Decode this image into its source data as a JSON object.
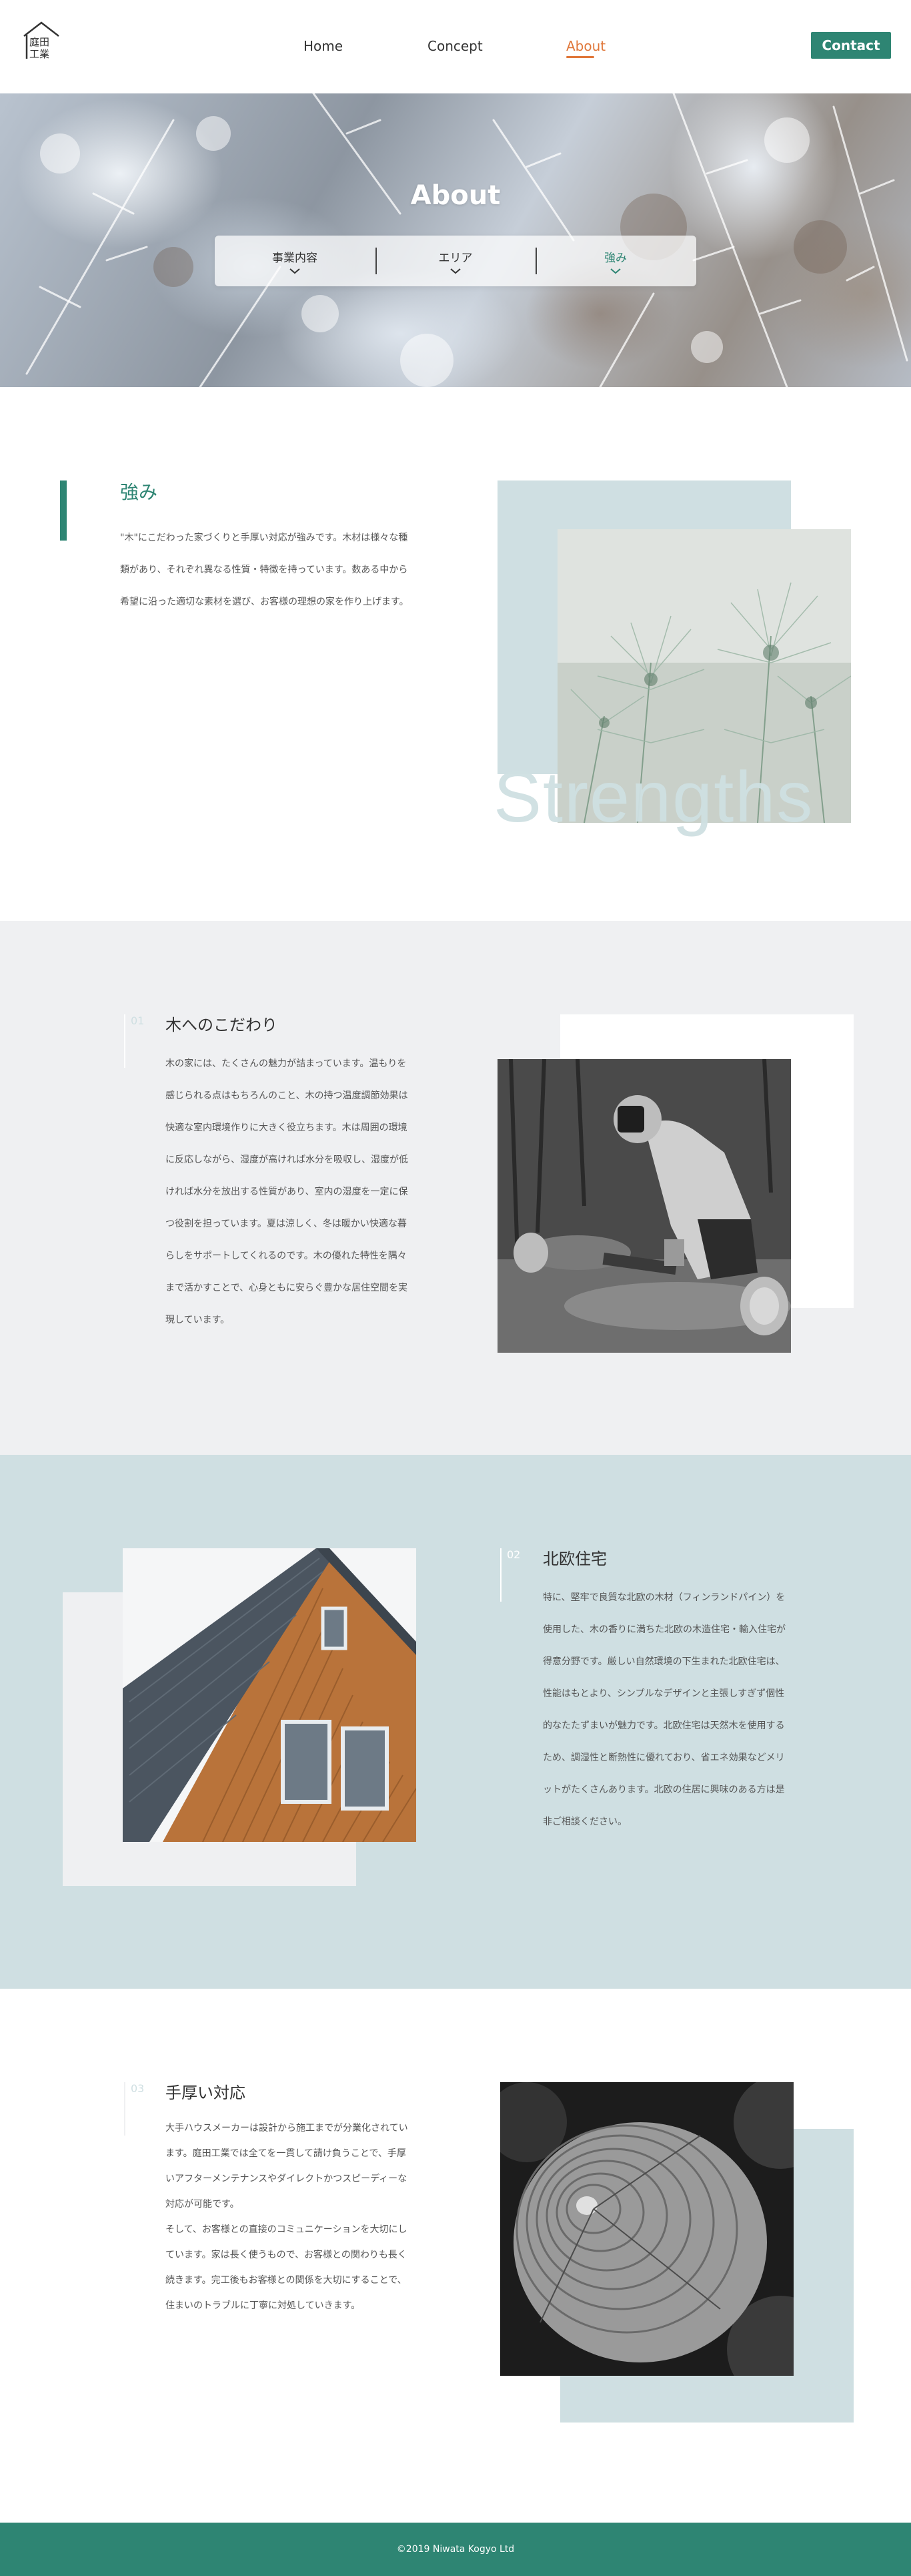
{
  "header": {
    "logo_text": "庭田工業",
    "nav": [
      {
        "label": "Home",
        "active": false
      },
      {
        "label": "Concept",
        "active": false
      },
      {
        "label": "About",
        "active": true
      }
    ],
    "contact_label": "Contact"
  },
  "hero": {
    "title": "About",
    "sub_nav": [
      {
        "label": "事業内容",
        "active": false
      },
      {
        "label": "エリア",
        "active": false
      },
      {
        "label": "強み",
        "active": true
      }
    ]
  },
  "strengths": {
    "title": "強み",
    "text": "\"木\"にこだわった家づくりと手厚い対応が強みです。木材は様々な種類があり、それぞれ異なる性質・特徴を持っています。数ある中から希望に沿った適切な素材を選び、お客様の理想の家を作り上げます。",
    "decor_word": "Strengths"
  },
  "sections": [
    {
      "num": "01",
      "title": "木へのこだわり",
      "text": "木の家には、たくさんの魅力が詰まっています。温もりを感じられる点はもちろんのこと、木の持つ温度調節効果は快適な室内環境作りに大きく役立ちます。木は周囲の環境に反応しながら、湿度が高ければ水分を吸収し、湿度が低ければ水分を放出する性質があり、室内の湿度を一定に保つ役割を担っています。夏は涼しく、冬は暖かい快適な暮らしをサポートしてくれるのです。木の優れた特性を隅々まで活かすことで、心身ともに安らぐ豊かな居住空間を実現しています。"
    },
    {
      "num": "02",
      "title": "北欧住宅",
      "text": "特に、堅牢で良質な北欧の木材（フィンランドパイン）を使用した、木の香りに満ちた北欧の木造住宅・輸入住宅が得意分野です。厳しい自然環境の下生まれた北欧住宅は、性能はもとより、シンプルなデザインと主張しすぎず個性的なたたずまいが魅力です。北欧住宅は天然木を使用するため、調湿性と断熱性に優れており、省エネ効果などメリットがたくさんあります。北欧の住居に興味のある方は是非ご相談ください。"
    },
    {
      "num": "03",
      "title": "手厚い対応",
      "text": "大手ハウスメーカーは設計から施工までが分業化されています。庭田工業では全てを一貫して請け負うことで、手厚いアフターメンテナンスやダイレクトかつスピーディーな対応が可能です。\nそして、お客様との直接のコミュニケーションを大切にしています。家は長く使うもので、お客様との関わりも長く続きます。完工後もお客様との関係を大切にすることで、住まいのトラブルに丁寧に対処していきます。"
    }
  ],
  "footer": {
    "copyright": "©2019 Niwata Kogyo Ltd"
  },
  "colors": {
    "accent": "#2e8573",
    "nav_active": "#e0773a",
    "light_blue": "#cfdfe2",
    "light_gray": "#eff0f2"
  }
}
